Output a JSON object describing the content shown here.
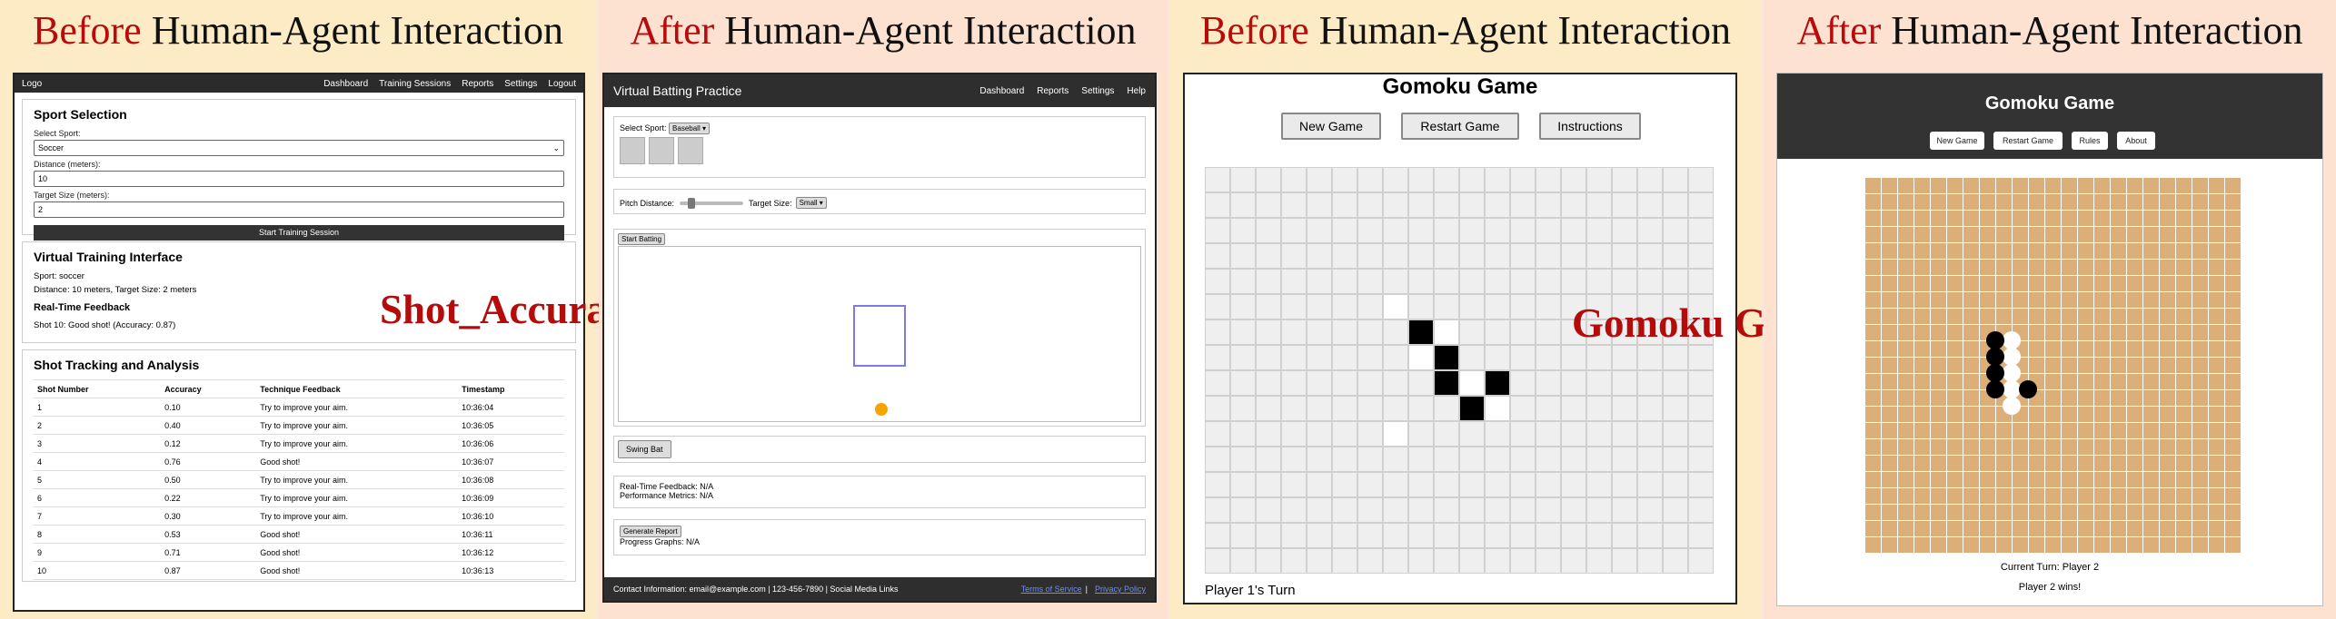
{
  "panels": {
    "p1": {
      "title_red": "Before",
      "title_black": " Human-Agent Interaction"
    },
    "p2": {
      "title_red": "After",
      "title_black": " Human-Agent Interaction"
    },
    "p3": {
      "title_red": "Before",
      "title_black": " Human-Agent Interaction"
    },
    "p4": {
      "title_red": "After",
      "title_black": " Human-Agent Interaction"
    }
  },
  "overlays": {
    "shot": "Shot_Accuracy_Trainer",
    "gomoku": "Gomoku Game"
  },
  "app1": {
    "nav": {
      "logo": "Logo",
      "links": [
        "Dashboard",
        "Training Sessions",
        "Reports",
        "Settings",
        "Logout"
      ]
    },
    "sport_selection": {
      "title": "Sport Selection",
      "sport_label": "Select Sport:",
      "sport_value": "Soccer",
      "distance_label": "Distance (meters):",
      "distance_value": "10",
      "target_label": "Target Size (meters):",
      "target_value": "2",
      "start_button": "Start Training Session"
    },
    "virtual": {
      "title": "Virtual Training Interface",
      "sport_line": "Sport: soccer",
      "distance_line": "Distance: 10 meters, Target Size: 2 meters",
      "feedback_title": "Real-Time Feedback",
      "feedback_line": "Shot 10: Good shot! (Accuracy: 0.87)"
    },
    "tracking": {
      "title": "Shot Tracking and Analysis",
      "headers": [
        "Shot Number",
        "Accuracy",
        "Technique Feedback",
        "Timestamp"
      ],
      "rows": [
        [
          "1",
          "0.10",
          "Try to improve your aim.",
          "10:36:04"
        ],
        [
          "2",
          "0.40",
          "Try to improve your aim.",
          "10:36:05"
        ],
        [
          "3",
          "0.12",
          "Try to improve your aim.",
          "10:36:06"
        ],
        [
          "4",
          "0.76",
          "Good shot!",
          "10:36:07"
        ],
        [
          "5",
          "0.50",
          "Try to improve your aim.",
          "10:36:08"
        ],
        [
          "6",
          "0.22",
          "Try to improve your aim.",
          "10:36:09"
        ],
        [
          "7",
          "0.30",
          "Try to improve your aim.",
          "10:36:10"
        ],
        [
          "8",
          "0.53",
          "Good shot!",
          "10:36:11"
        ],
        [
          "9",
          "0.71",
          "Good shot!",
          "10:36:12"
        ],
        [
          "10",
          "0.87",
          "Good shot!",
          "10:36:13"
        ]
      ]
    }
  },
  "app2": {
    "title": "Virtual Batting Practice",
    "nav_links": [
      "Dashboard",
      "Reports",
      "Settings",
      "Help"
    ],
    "select_sport_label": "Select Sport:",
    "select_sport_value": "Baseball",
    "pitch_label": "Pitch Distance:",
    "pitch_level": 0.15,
    "target_label": "Target Size:",
    "target_value": "Small",
    "start_button": "Start Batting",
    "swing_button": "Swing Bat",
    "feedback_line": "Real-Time Feedback: N/A",
    "metrics_line": "Performance Metrics: N/A",
    "report_button": "Generate Report",
    "graphs_line": "Progress Graphs: N/A",
    "footer": "Contact Information: email@example.com | 123-456-7890 | Social Media Links",
    "footer_link1": "Terms of Service",
    "footer_sep": "|",
    "footer_link2": "Privacy Policy",
    "ball_color": "#f5a500",
    "target_color": "#7a7ae0"
  },
  "app3": {
    "title": "Gomoku Game",
    "buttons": [
      "New Game",
      "Restart Game",
      "Instructions"
    ],
    "status": "Player 1's Turn",
    "board_size": 20,
    "black_stones": [
      [
        6,
        8
      ],
      [
        7,
        9
      ],
      [
        8,
        9
      ],
      [
        8,
        11
      ],
      [
        9,
        10
      ]
    ],
    "white_stones": [
      [
        5,
        7
      ],
      [
        6,
        9
      ],
      [
        7,
        8
      ],
      [
        8,
        10
      ],
      [
        9,
        11
      ],
      [
        10,
        7
      ]
    ]
  },
  "app4": {
    "title": "Gomoku Game",
    "buttons": [
      "New Game",
      "Restart Game",
      "Rules",
      "About"
    ],
    "turn_text": "Current Turn: Player 2",
    "winner_text": "Player 2 wins!",
    "board_size": 23,
    "board_color": "#dcae78",
    "black_stones": [
      [
        10,
        8
      ],
      [
        11,
        8
      ],
      [
        12,
        8
      ],
      [
        13,
        8
      ],
      [
        13,
        10
      ]
    ],
    "white_stones": [
      [
        10,
        9
      ],
      [
        11,
        9
      ],
      [
        12,
        9
      ],
      [
        13,
        9
      ],
      [
        14,
        9
      ]
    ]
  }
}
